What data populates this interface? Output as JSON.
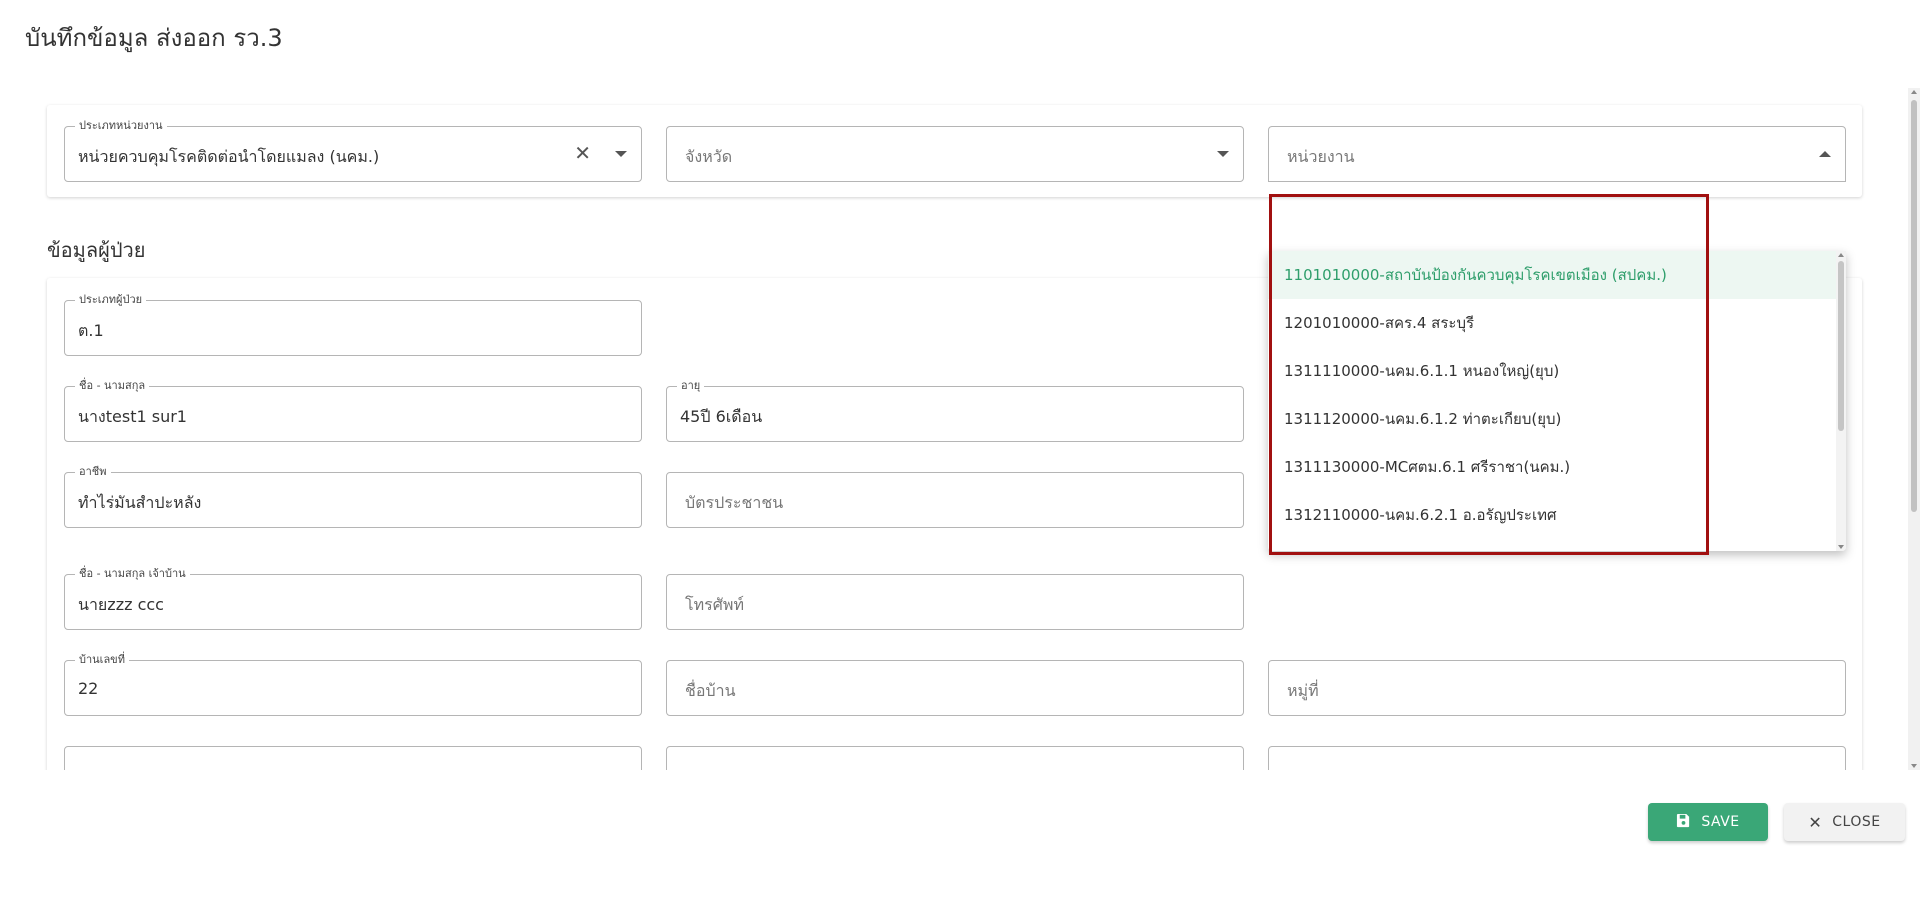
{
  "page": {
    "title": "บันทึกข้อมูล ส่งออก รว.3"
  },
  "unit_filter": {
    "unit_type": {
      "label": "ประเภทหน่วยงาน",
      "value": "หน่วยควบคุมโรคติดต่อนำโดยแมลง (นคม.)",
      "clear_icon": "✕"
    },
    "province": {
      "placeholder": "จังหวัด"
    },
    "unit": {
      "placeholder": "หน่วยงาน",
      "options": [
        "1101010000-สถาบันป้องกันควบคุมโรคเขตเมือง (สปคม.)",
        "1201010000-สคร.4 สระบุรี",
        "1311110000-นคม.6.1.1 หนองใหญ่(ยุบ)",
        "1311120000-นคม.6.1.2 ท่าตะเกียบ(ยุบ)",
        "1311130000-MCศตม.6.1 ศรีราชา(นคม.)",
        "1312110000-นคม.6.2.1 อ.อรัญประเทศ"
      ],
      "selected_index": 0
    }
  },
  "patient": {
    "section_title": "ข้อมูลผู้ป่วย",
    "patient_type": {
      "label": "ประเภทผู้ป่วย",
      "value": "ต.1"
    },
    "name": {
      "label": "ชื่อ - นามสกุล",
      "value": "นางtest1 sur1"
    },
    "age": {
      "label": "อายุ",
      "value": "45ปี 6เดือน"
    },
    "occupation": {
      "label": "อาชีพ",
      "value": "ทำไร่มันสำปะหลัง"
    },
    "id_card": {
      "placeholder": "บัตรประชาชน"
    },
    "owner_name": {
      "label": "ชื่อ - นามสกุล เจ้าบ้าน",
      "value": "นายzzz ccc"
    },
    "phone": {
      "placeholder": "โทรศัพท์"
    },
    "house_no": {
      "label": "บ้านเลขที่",
      "value": "22"
    },
    "village_name": {
      "placeholder": "ชื่อบ้าน"
    },
    "moo": {
      "placeholder": "หมู่ที่"
    }
  },
  "footer": {
    "save_label": "SAVE",
    "close_label": "CLOSE",
    "save_icon": "💾",
    "close_icon": "✕"
  },
  "colors": {
    "accent": "#3aa777",
    "highlight": "#a11010"
  }
}
